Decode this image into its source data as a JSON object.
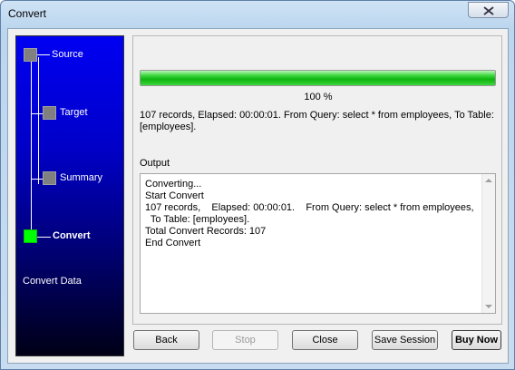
{
  "window": {
    "title": "Convert"
  },
  "steps": [
    {
      "label": "Source",
      "state": "done"
    },
    {
      "label": "Target",
      "state": "done"
    },
    {
      "label": "Summary",
      "state": "done"
    },
    {
      "label": "Convert",
      "state": "active"
    }
  ],
  "sidebar_caption": "Convert Data",
  "progress": {
    "fraction": 1.0,
    "text": "100 %"
  },
  "summary_text": "107 records,    Elapsed: 00:00:01.    From Query: select * from employees,    To Table: [employees].",
  "output": {
    "label": "Output",
    "lines": [
      "Converting...",
      "Start Convert",
      "107 records,    Elapsed: 00:00:01.    From Query: select * from employees,",
      "  To Table: [employees].",
      "Total Convert Records: 107",
      "End Convert"
    ]
  },
  "buttons": {
    "back": "Back",
    "stop": "Stop",
    "close": "Close",
    "save_session": "Save Session",
    "buy_now": "Buy Now"
  },
  "colors": {
    "progress": "#1fc21f",
    "active_step": "#00ff00",
    "inactive_step": "#808080"
  }
}
